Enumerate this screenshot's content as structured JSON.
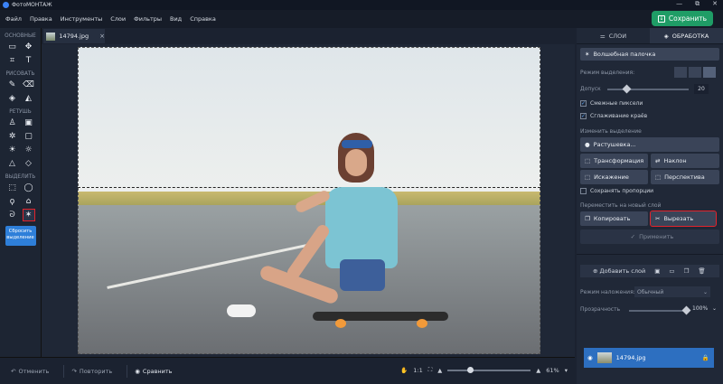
{
  "app": {
    "title": "ФотоМОНТАЖ",
    "win_min": "—",
    "win_max": "⧉",
    "win_close": "✕"
  },
  "menu": [
    "Файл",
    "Правка",
    "Инструменты",
    "Слои",
    "Фильтры",
    "Вид",
    "Справка"
  ],
  "save_button": "Сохранить",
  "toolbar": {
    "sections": [
      "ОСНОВНЫЕ",
      "РИСОВАТЬ",
      "РЕТУШЬ",
      "ВЫДЕЛИТЬ"
    ],
    "reset_label_1": "Сбросить",
    "reset_label_2": "выделение"
  },
  "document_tab": {
    "filename": "14794.jpg",
    "close": "×"
  },
  "statusbar": {
    "undo": "Отменить",
    "redo": "Повторить",
    "compare": "Сравнить",
    "ratio": "1:1",
    "zoom": "61%"
  },
  "right_panel": {
    "tabs": [
      "СЛОИ",
      "ОБРАБОТКА"
    ],
    "active_tab": "ОБРАБОТКА",
    "tool_button": "Волшебная палочка",
    "selection_mode_label": "Режим выделения:",
    "tolerance_label": "Допуск",
    "tolerance_value": "20",
    "tolerance_fraction": 0.2,
    "checks": [
      "Смежные пиксели",
      "Сглаживание краёв"
    ],
    "edit_selection_label": "Изменить выделение",
    "feather_button": "Растушевка...",
    "transform_buttons": [
      "Трансформация",
      "Наклон",
      "Искажение",
      "Перспектива"
    ],
    "keep_proportions": "Сохранять пропорции",
    "move_to_layer_label": "Переместить на новый слой",
    "copy_button": "Копировать",
    "cut_button": "Вырезать",
    "apply_button": "Применить",
    "add_layer_button": "Добавить слой",
    "blend_mode_label": "Режим наложения:",
    "blend_mode_value": "Обычный",
    "opacity_label": "Прозрачность",
    "opacity_value": "100%",
    "layer_name": "14794.jpg"
  }
}
